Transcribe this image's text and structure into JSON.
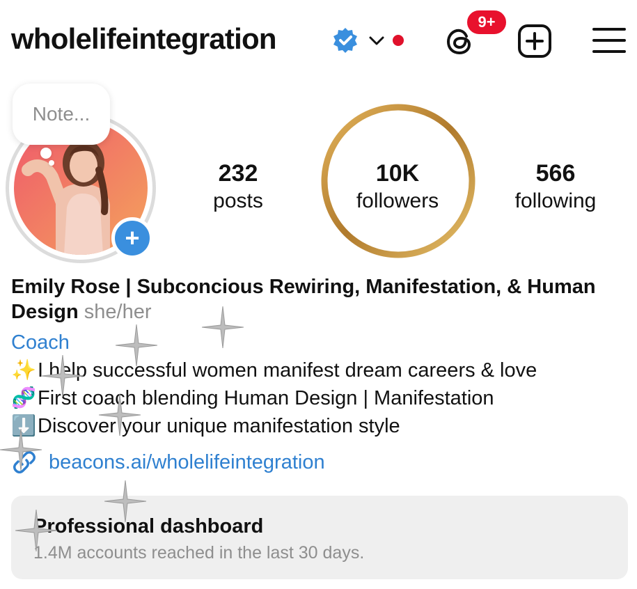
{
  "header": {
    "username": "wholelifeintegration",
    "notification_badge": "9+",
    "icons": [
      "verified-badge-icon",
      "chevron-down-icon",
      "threads-icon",
      "new-post-icon",
      "menu-icon"
    ]
  },
  "profile": {
    "note_placeholder": "Note...",
    "add_story_label": "+"
  },
  "stats": {
    "posts": {
      "value": "232",
      "label": "posts"
    },
    "followers": {
      "value": "10K",
      "label": "followers"
    },
    "following": {
      "value": "566",
      "label": "following"
    }
  },
  "bio": {
    "name": "Emily Rose | Subconcious Rewiring, Manifestation, & Human Design",
    "pronouns": "she/her",
    "category": "Coach",
    "line1_emoji": "✨",
    "line1": "I help successful women manifest dream careers & love",
    "line2_emoji": "🧬",
    "line2": "First coach blending Human Design | Manifestation",
    "line3_emoji": "⬇️",
    "line3": "Discover your unique manifestation style",
    "link": "beacons.ai/wholelifeintegration"
  },
  "dashboard": {
    "title": "Professional dashboard",
    "subtitle": "1.4M accounts reached in the last 30 days."
  },
  "colors": {
    "accent_blue": "#2f80d0",
    "badge_red": "#e8112d",
    "gold_ring": "#c79a3a",
    "add_story_blue": "#3a8fde"
  }
}
